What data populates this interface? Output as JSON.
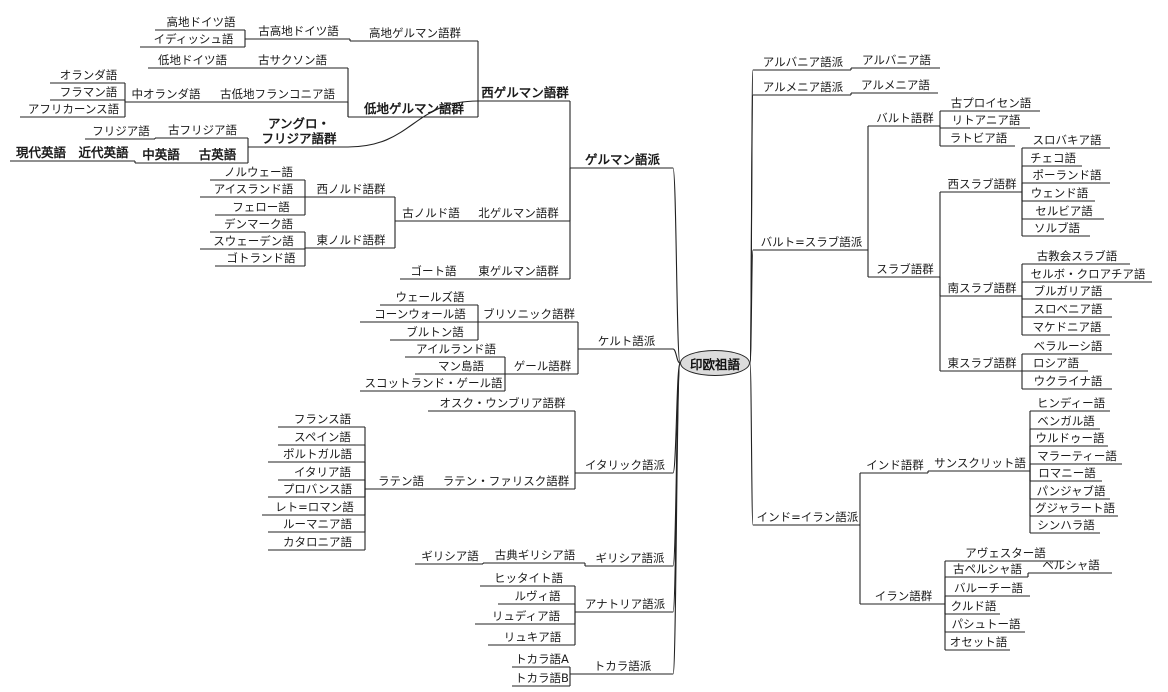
{
  "root": "印欧祖語",
  "line_color": "#222222",
  "left_tree": [
    {
      "name": "ゲルマン語派",
      "bold": true,
      "children": [
        {
          "name": "西ゲルマン語群",
          "bold": true,
          "children": [
            {
              "name": "高地ゲルマン語群",
              "children": [
                {
                  "name": "古高地ドイツ語",
                  "children": [
                    {
                      "name": "高地ドイツ語"
                    },
                    {
                      "name": "イディッシュ語"
                    }
                  ]
                }
              ]
            },
            {
              "name": "低地ゲルマン語群",
              "bold": true,
              "children": [
                {
                  "name": "古サクソン語",
                  "children": [
                    {
                      "name": "低地ドイツ語"
                    }
                  ]
                },
                {
                  "name": "古低地フランコニア語",
                  "children": [
                    {
                      "name": "中オランダ語",
                      "children": [
                        {
                          "name": "オランダ語"
                        },
                        {
                          "name": "フラマン語"
                        },
                        {
                          "name": "アフリカーンス語"
                        }
                      ]
                    }
                  ]
                }
              ]
            },
            {
              "name": "アングロ・フリジア語群",
              "bold": true,
              "children": [
                {
                  "name": "古フリジア語",
                  "children": [
                    {
                      "name": "フリジア語"
                    }
                  ]
                },
                {
                  "name": "古英語",
                  "bold": true,
                  "children": [
                    {
                      "name": "中英語",
                      "bold": true,
                      "children": [
                        {
                          "name": "近代英語",
                          "bold": true,
                          "children": [
                            {
                              "name": "現代英語",
                              "bold": true
                            }
                          ]
                        }
                      ]
                    }
                  ]
                }
              ]
            }
          ]
        },
        {
          "name": "北ゲルマン語群",
          "children": [
            {
              "name": "古ノルド語",
              "children": [
                {
                  "name": "西ノルド語群",
                  "children": [
                    {
                      "name": "ノルウェー語"
                    },
                    {
                      "name": "アイスランド語"
                    },
                    {
                      "name": "フェロー語"
                    }
                  ]
                },
                {
                  "name": "東ノルド語群",
                  "children": [
                    {
                      "name": "デンマーク語"
                    },
                    {
                      "name": "スウェーデン語"
                    },
                    {
                      "name": "ゴトランド語"
                    }
                  ]
                }
              ]
            }
          ]
        },
        {
          "name": "東ゲルマン語群",
          "children": [
            {
              "name": "ゴート語"
            }
          ]
        }
      ]
    },
    {
      "name": "ケルト語派",
      "children": [
        {
          "name": "ブリソニック語群",
          "children": [
            {
              "name": "ウェールズ語"
            },
            {
              "name": "コーンウォール語"
            },
            {
              "name": "ブルトン語"
            }
          ]
        },
        {
          "name": "ゲール語群",
          "children": [
            {
              "name": "アイルランド語"
            },
            {
              "name": "マン島語"
            },
            {
              "name": "スコットランド・ゲール語"
            }
          ]
        }
      ]
    },
    {
      "name": "イタリック語派",
      "children": [
        {
          "name": "オスク・ウンブリア語群"
        },
        {
          "name": "ラテン・ファリスク語群",
          "children": [
            {
              "name": "ラテン語",
              "children": [
                {
                  "name": "フランス語"
                },
                {
                  "name": "スペイン語"
                },
                {
                  "name": "ポルトガル語"
                },
                {
                  "name": "イタリア語"
                },
                {
                  "name": "プロバンス語"
                },
                {
                  "name": "レト=ロマン語"
                },
                {
                  "name": "ルーマニア語"
                },
                {
                  "name": "カタロニア語"
                }
              ]
            }
          ]
        }
      ]
    },
    {
      "name": "ギリシア語派",
      "children": [
        {
          "name": "古典ギリシア語",
          "children": [
            {
              "name": "ギリシア語"
            }
          ]
        }
      ]
    },
    {
      "name": "アナトリア語派",
      "children": [
        {
          "name": "ヒッタイト語"
        },
        {
          "name": "ルヴィ語"
        },
        {
          "name": "リュディア語"
        },
        {
          "name": "リュキア語"
        }
      ]
    },
    {
      "name": "トカラ語派",
      "children": [
        {
          "name": "トカラ語A"
        },
        {
          "name": "トカラ語B"
        }
      ]
    }
  ],
  "right_tree": [
    {
      "name": "アルバニア語派",
      "children": [
        {
          "name": "アルバニア語"
        }
      ]
    },
    {
      "name": "アルメニア語派",
      "children": [
        {
          "name": "アルメニア語"
        }
      ]
    },
    {
      "name": "バルト=スラブ語派",
      "children": [
        {
          "name": "バルト語群",
          "children": [
            {
              "name": "古プロイセン語"
            },
            {
              "name": "リトアニア語"
            },
            {
              "name": "ラトビア語"
            }
          ]
        },
        {
          "name": "スラブ語群",
          "children": [
            {
              "name": "西スラブ語群",
              "children": [
                {
                  "name": "スロバキア語"
                },
                {
                  "name": "チェコ語"
                },
                {
                  "name": "ポーランド語"
                },
                {
                  "name": "ウェンド語"
                },
                {
                  "name": "セルビア語"
                },
                {
                  "name": "ソルブ語"
                }
              ]
            },
            {
              "name": "南スラブ語群",
              "children": [
                {
                  "name": "古教会スラブ語"
                },
                {
                  "name": "セルボ・クロアチア語"
                },
                {
                  "name": "ブルガリア語"
                },
                {
                  "name": "スロベニア語"
                },
                {
                  "name": "マケドニア語"
                }
              ]
            },
            {
              "name": "東スラブ語群",
              "children": [
                {
                  "name": "ベラルーシ語"
                },
                {
                  "name": "ロシア語"
                },
                {
                  "name": "ウクライナ語"
                }
              ]
            }
          ]
        }
      ]
    },
    {
      "name": "インド=イラン語派",
      "children": [
        {
          "name": "インド語群",
          "children": [
            {
              "name": "サンスクリット語",
              "children": [
                {
                  "name": "ヒンディー語"
                },
                {
                  "name": "ベンガル語"
                },
                {
                  "name": "ウルドゥー語"
                },
                {
                  "name": "マラーティー語"
                },
                {
                  "name": "ロマニー語"
                },
                {
                  "name": "パンジャブ語"
                },
                {
                  "name": "グジャラート語"
                },
                {
                  "name": "シンハラ語"
                }
              ]
            }
          ]
        },
        {
          "name": "イラン語群",
          "children": [
            {
              "name": "アヴェスター語"
            },
            {
              "name": "古ペルシャ語",
              "children": [
                {
                  "name": "ペルシャ語"
                }
              ]
            },
            {
              "name": "バルーチー語"
            },
            {
              "name": "クルド語"
            },
            {
              "name": "パシュトー語"
            },
            {
              "name": "オセット語"
            }
          ]
        }
      ]
    }
  ]
}
